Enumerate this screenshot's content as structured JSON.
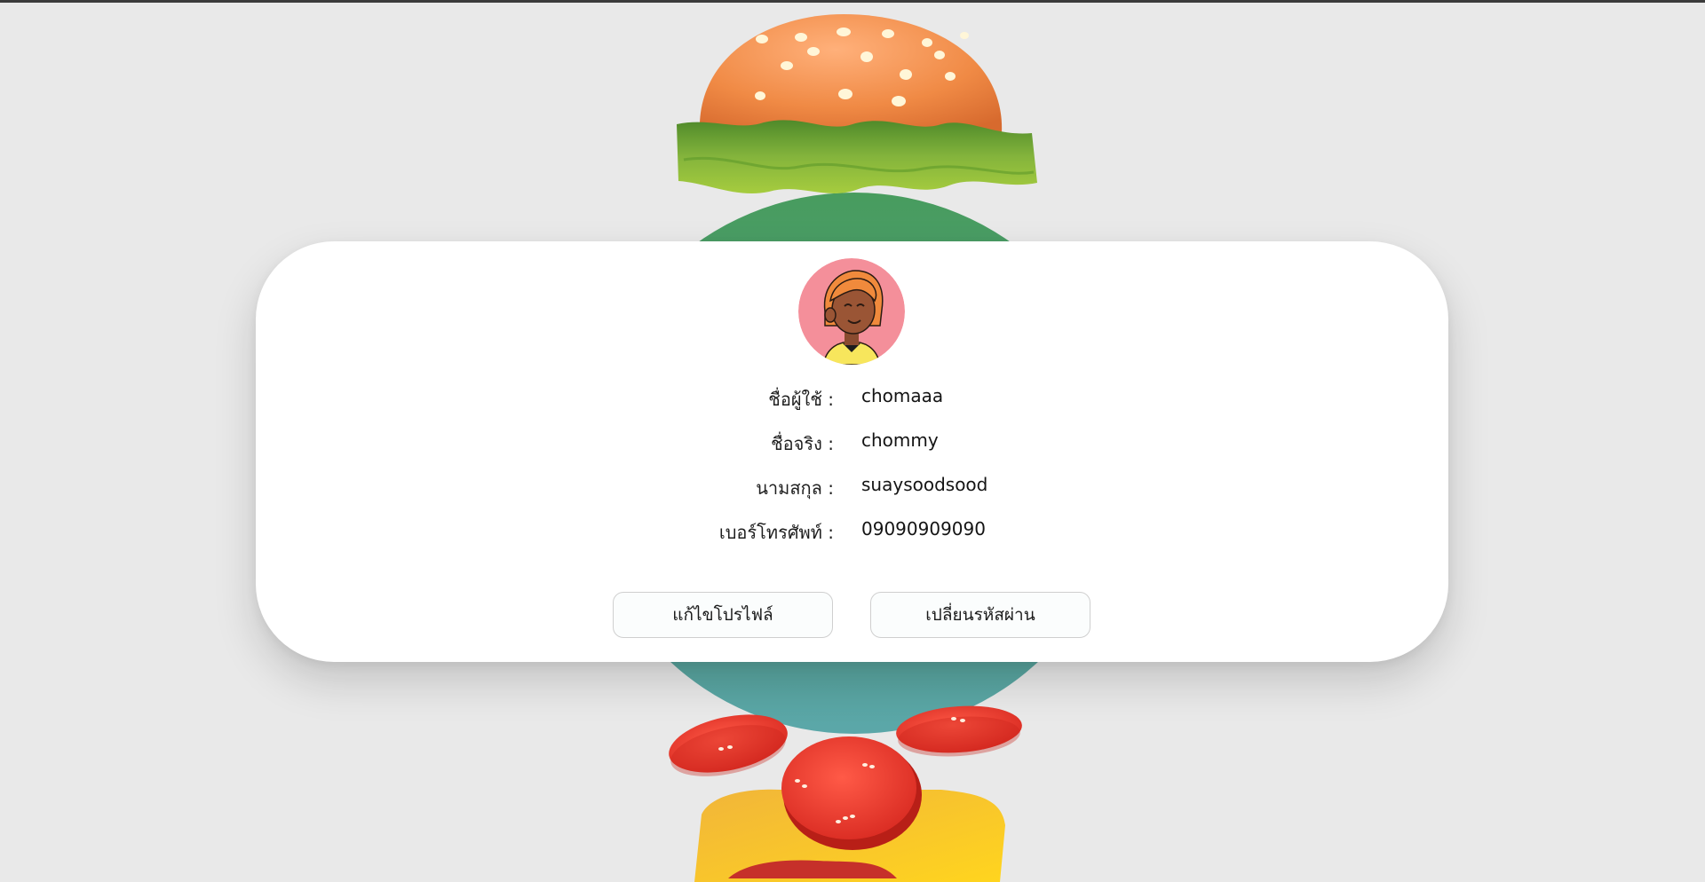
{
  "profile": {
    "rows": [
      {
        "label": "ชื่อผู้ใช้ :",
        "value": "chomaaa"
      },
      {
        "label": "ชื่อจริง :",
        "value": "chommy"
      },
      {
        "label": "นามสกุล :",
        "value": "suaysoodsood"
      },
      {
        "label": "เบอร์โทรศัพท์ :",
        "value": "09090909090"
      }
    ],
    "avatar_icon": "girl-avatar-icon"
  },
  "actions": {
    "edit_label": "แก้ไขโปรไฟล์",
    "change_password_label": "เปลี่ยนรหัสผ่าน"
  },
  "colors": {
    "background": "#e9e9e9",
    "card": "#ffffff",
    "circle_top": "#4e9f6a",
    "circle_bottom": "#5aa6a6",
    "bun": "#f08a45",
    "lettuce": "#7fae3a",
    "tomato": "#e8382e",
    "cheese": "#f5c531",
    "avatar_bg": "#f48f9a"
  }
}
